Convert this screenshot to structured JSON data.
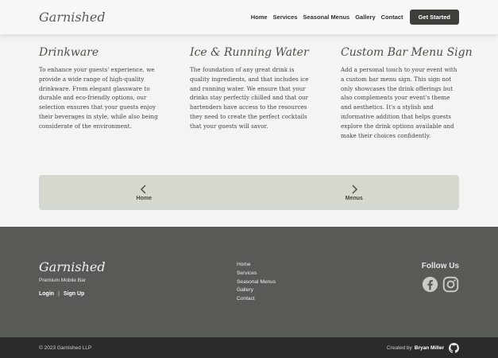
{
  "nav": {
    "brand": "Garnished",
    "links": [
      "Home",
      "Services",
      "Seasonal Menus",
      "Gallery",
      "Contact"
    ],
    "cta": "Get Started"
  },
  "services": [
    {
      "title": "Drinkware",
      "text": "To enhance your guests' experience, we provide a wide range of high-quality drinkware. From elegant glassware to durable and eco-friendly options, our selection ensures that your guests enjoy their beverages in style, while also being considerate of the environment."
    },
    {
      "title": "Ice & Running Water",
      "text": "The foundation of any great drink is quality ingredients, and that includes ice and running water. We ensure that your drinks stay perfectly chilled and that our bartenders have access to the resources they need to create the perfect cocktails that your guests will savor."
    },
    {
      "title": "Custom Bar Menu Sign",
      "text": "Add a personal touch to your event with a custom bar menu sign. This sign not only showcases the drink offerings but also complements your event's theme and aesthetics. It's a stylish and informative addition that helps guests explore the drink options available and make their choices confidently."
    }
  ],
  "pager": {
    "prev": "Home",
    "next": "Menus"
  },
  "footer": {
    "brand": "Garnished",
    "tagline": "Premium Mobile Bar",
    "login": "Login",
    "separator": "|",
    "signup": "Sign Up",
    "links": [
      "Home",
      "Services",
      "Seasonal Menus",
      "Gallery",
      "Contact"
    ],
    "follow": "Follow Us",
    "social_icons": [
      "facebook-icon",
      "instagram-icon"
    ]
  },
  "bottom": {
    "copyright": "© 2023 Garnished LLP",
    "credit_prefix": "Created by",
    "credit_name": "Bryan Miller",
    "credit_icon": "github-icon"
  },
  "colors": {
    "nav_bg": "#f8f8f8",
    "cta_bg": "#3e3f3b",
    "pager_bg": "#d5d8ce",
    "footer_bg": "#585a56",
    "bottom_bg": "#2b2c29"
  }
}
